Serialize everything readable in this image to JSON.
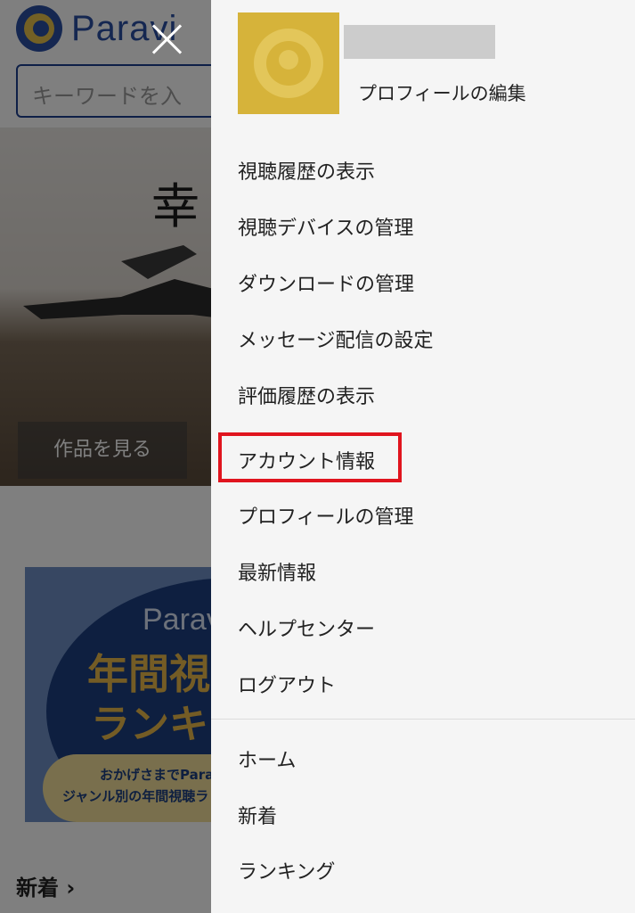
{
  "background": {
    "logo_text": "Paravi",
    "search_placeholder": "キーワードを入",
    "hero_title": "幸",
    "hero_button": "作品を見る",
    "banner": {
      "brand": "Parav",
      "line1": "年間視",
      "line2": "ランキ",
      "sub1": "おかげさまでPara",
      "sub2": "ジャンル別の年間視聴ラ"
    },
    "section_title": "新着",
    "section_chevron": "›"
  },
  "menu": {
    "profile": {
      "edit_label": "プロフィールの編集"
    },
    "items": [
      {
        "label": "視聴履歴の表示"
      },
      {
        "label": "視聴デバイスの管理"
      },
      {
        "label": "ダウンロードの管理"
      },
      {
        "label": "メッセージ配信の設定"
      },
      {
        "label": "評価履歴の表示"
      },
      {
        "label": "アカウント情報"
      },
      {
        "label": "プロフィールの管理"
      },
      {
        "label": "最新情報"
      },
      {
        "label": "ヘルプセンター"
      },
      {
        "label": "ログアウト"
      }
    ],
    "nav": [
      {
        "label": "ホーム"
      },
      {
        "label": "新着"
      },
      {
        "label": "ランキング"
      }
    ]
  },
  "colors": {
    "highlight_border": "#e0141e",
    "brand_blue": "#2a4fa3",
    "brand_gold": "#d6b33a"
  }
}
